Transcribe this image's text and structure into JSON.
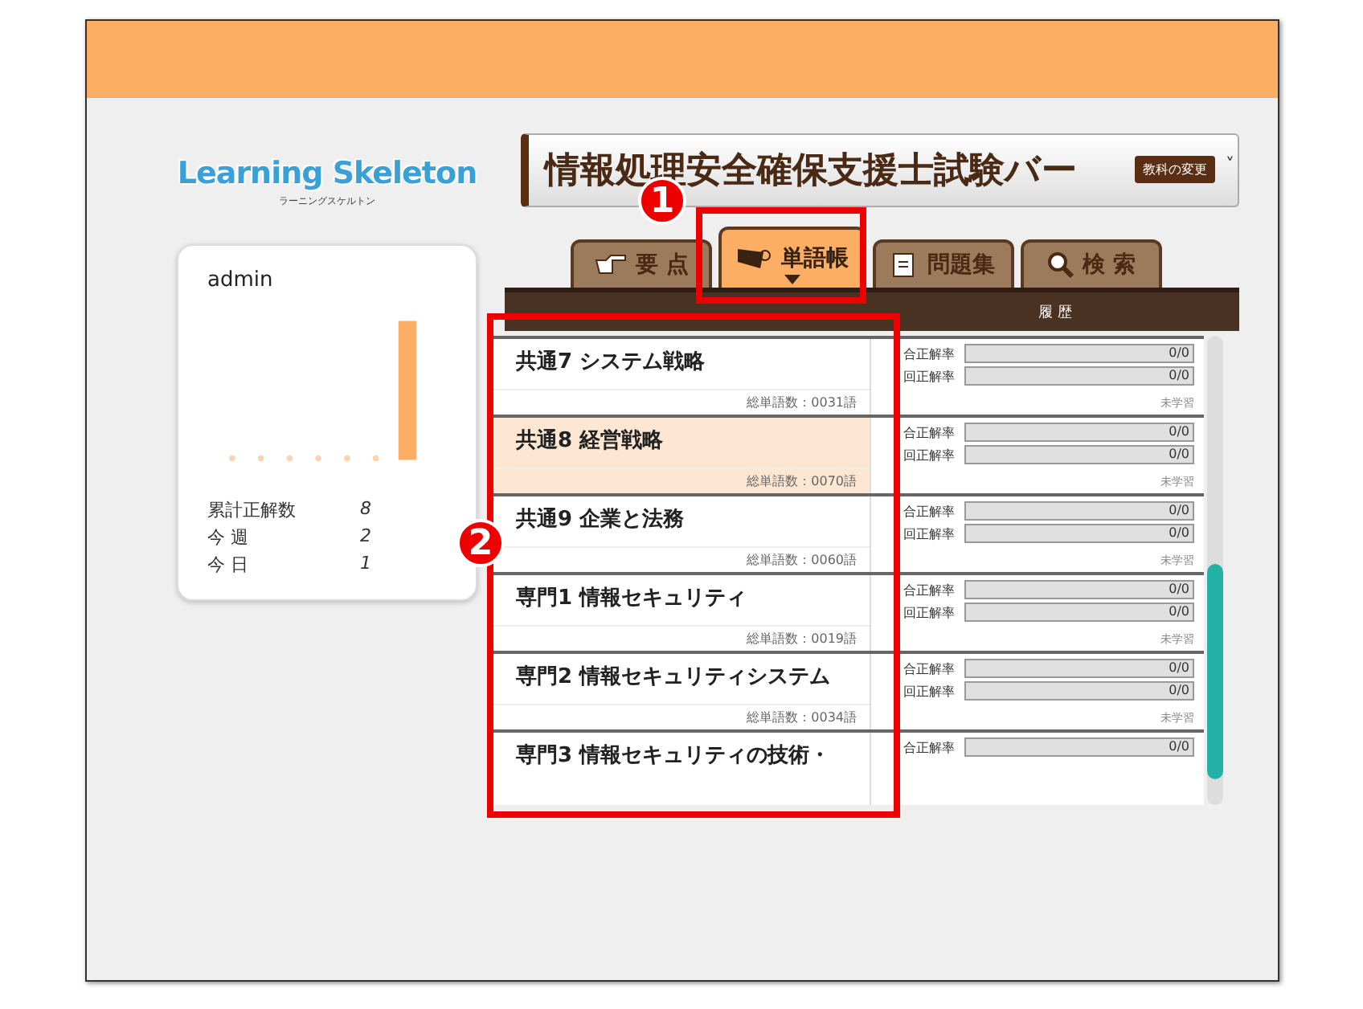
{
  "logo": {
    "title": "Learning Skeleton",
    "subtitle": "ラーニングスケルトン"
  },
  "user_card": {
    "name": "admin",
    "stats": [
      {
        "label": "累計正解数",
        "value": "8"
      },
      {
        "label": "今 週",
        "value": "2"
      },
      {
        "label": "今 日",
        "value": "1"
      }
    ]
  },
  "course": {
    "title": "情報処理安全確保支援士試験バー",
    "change_button": "教科の変更",
    "caret": "˅"
  },
  "tabs": [
    {
      "label": "要 点",
      "kind": "hand",
      "selected": false
    },
    {
      "label": "単語帳",
      "kind": "cards",
      "selected": true
    },
    {
      "label": "問題集",
      "kind": "note",
      "selected": false
    },
    {
      "label": "検 索",
      "kind": "search",
      "selected": false
    }
  ],
  "table": {
    "columns": [
      "履 歴"
    ],
    "rows": [
      {
        "title": "共通7 システム戦略",
        "count": "総単語数：0031語",
        "status": "未学習",
        "highlighted": false,
        "stats": [
          {
            "label": "合正解率",
            "value": "0/0",
            "level": 0
          },
          {
            "label": "回正解率",
            "value": "0/0",
            "level": 0
          }
        ]
      },
      {
        "title": "共通8 経営戦略",
        "count": "総単語数：0070語",
        "status": "未学習",
        "highlighted": true,
        "stats": [
          {
            "label": "合正解率",
            "value": "0/0",
            "level": 0
          },
          {
            "label": "回正解率",
            "value": "0/0",
            "level": 0
          }
        ]
      },
      {
        "title": "共通9 企業と法務",
        "count": "総単語数：0060語",
        "status": "未学習",
        "highlighted": false,
        "stats": [
          {
            "label": "合正解率",
            "value": "0/0",
            "level": 0
          },
          {
            "label": "回正解率",
            "value": "0/0",
            "level": 0
          }
        ]
      },
      {
        "title": "専門1 情報セキュリティ",
        "count": "総単語数：0019語",
        "status": "未学習",
        "highlighted": false,
        "stats": [
          {
            "label": "合正解率",
            "value": "0/0",
            "level": 0
          },
          {
            "label": "回正解率",
            "value": "0/0",
            "level": 0
          }
        ]
      },
      {
        "title": "専門2 情報セキュリティシステム",
        "count": "総単語数：0034語",
        "status": "未学習",
        "highlighted": false,
        "stats": [
          {
            "label": "合正解率",
            "value": "0/0",
            "level": 0
          },
          {
            "label": "回正解率",
            "value": "0/0",
            "level": 0
          }
        ]
      },
      {
        "title": "専門3 情報セキュリティの技術・",
        "stats": [
          {
            "label": "合正解率",
            "value": "0/0",
            "level": 0
          }
        ]
      }
    ]
  },
  "annotations": [
    {
      "number": "1"
    },
    {
      "number": "2"
    }
  ]
}
